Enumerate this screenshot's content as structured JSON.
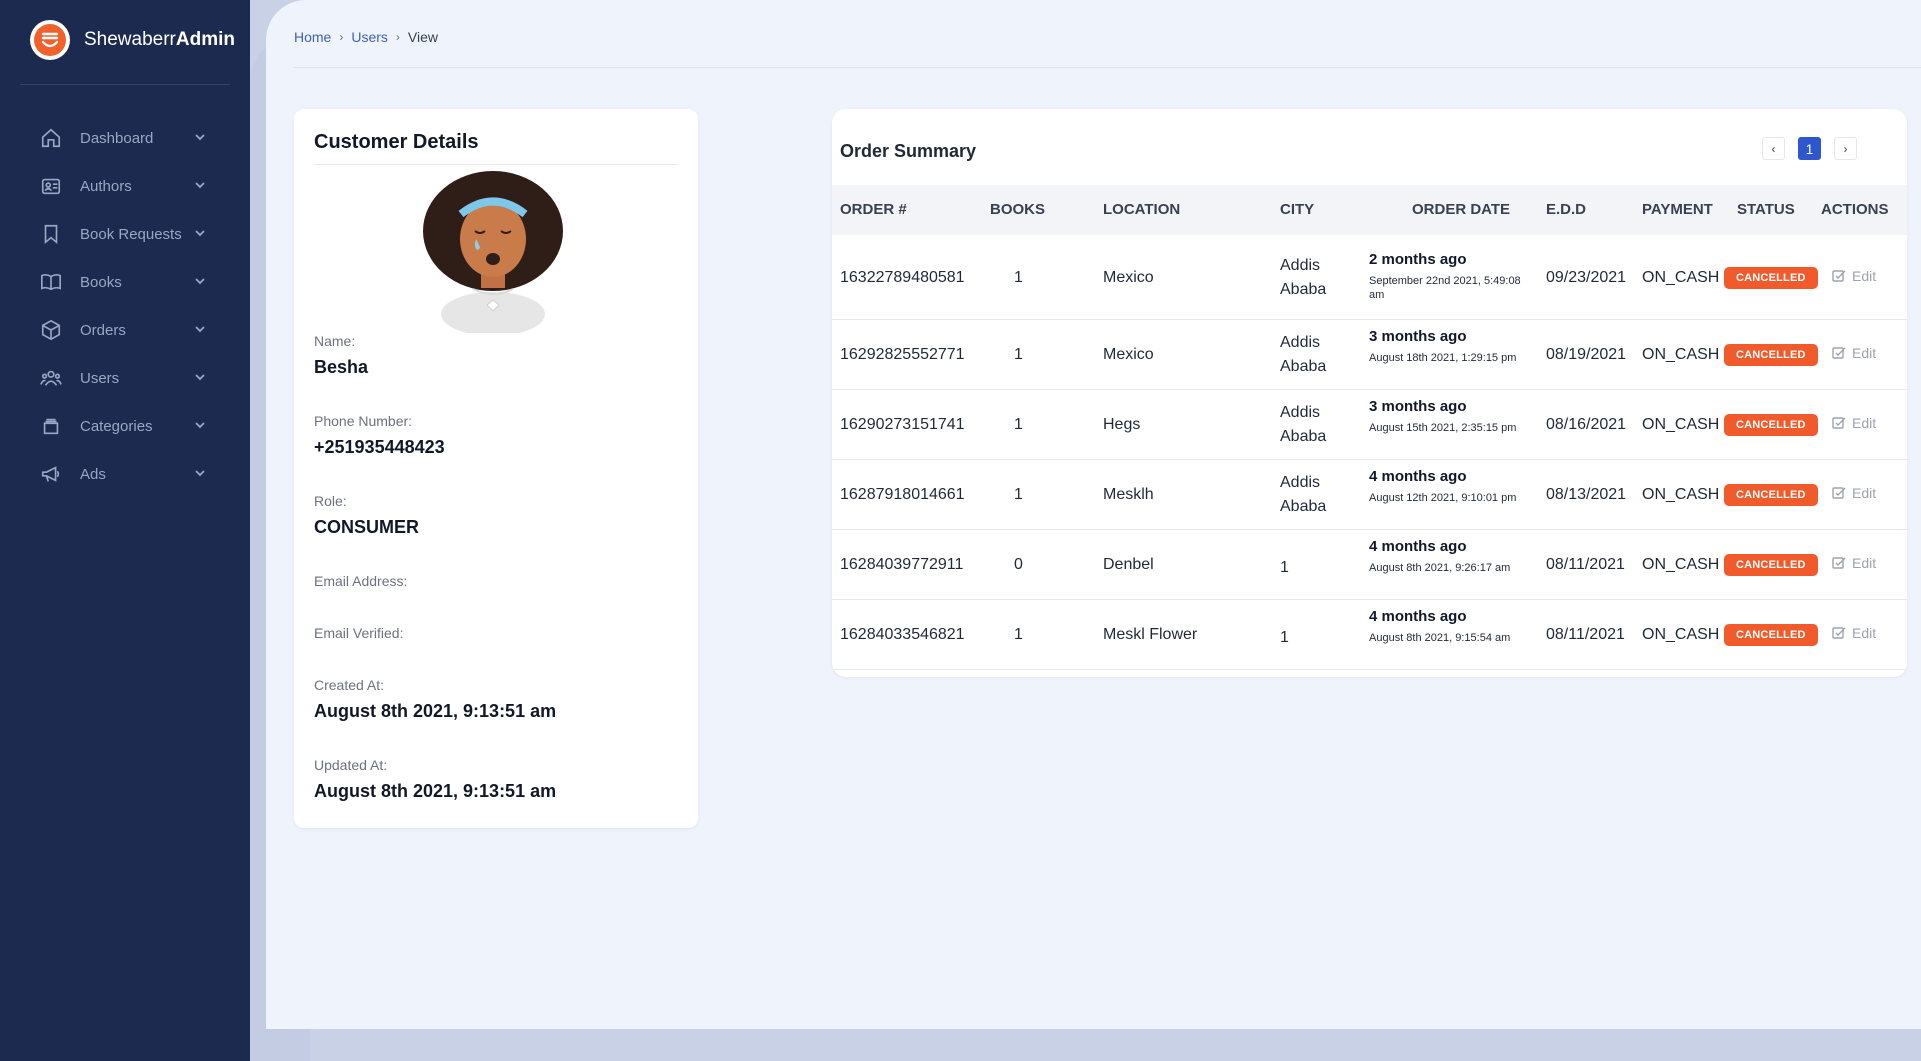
{
  "app": {
    "brand_prefix": "Shewaberr",
    "brand_suffix": "Admin"
  },
  "sidebar": {
    "items": [
      {
        "label": "Dashboard",
        "icon": "home-icon"
      },
      {
        "label": "Authors",
        "icon": "id-card-icon"
      },
      {
        "label": "Book Requests",
        "icon": "bookmark-icon"
      },
      {
        "label": "Books",
        "icon": "book-open-icon"
      },
      {
        "label": "Orders",
        "icon": "cube-icon"
      },
      {
        "label": "Users",
        "icon": "users-icon"
      },
      {
        "label": "Categories",
        "icon": "archive-icon"
      },
      {
        "label": "Ads",
        "icon": "megaphone-icon"
      }
    ]
  },
  "breadcrumb": {
    "home": "Home",
    "users": "Users",
    "current": "View"
  },
  "customer": {
    "title": "Customer Details",
    "name_label": "Name:",
    "name": "Besha",
    "phone_label": "Phone Number:",
    "phone": "+251935448423",
    "role_label": "Role:",
    "role": "CONSUMER",
    "email_label": "Email Address:",
    "email_verified_label": "Email Verified:",
    "created_label": "Created At:",
    "created": "August 8th 2021, 9:13:51 am",
    "updated_label": "Updated At:",
    "updated": "August 8th 2021, 9:13:51 am"
  },
  "orders": {
    "title": "Order Summary",
    "pager": {
      "prev": "‹",
      "page": "1",
      "next": "›"
    },
    "columns": [
      "ORDER #",
      "BOOKS",
      "LOCATION",
      "CITY",
      "ORDER DATE",
      "E.D.D",
      "PAYMENT",
      "STATUS",
      "ACTIONS"
    ],
    "edit_label": "Edit",
    "rows": [
      {
        "order": "16322789480581",
        "books": "1",
        "location": "Mexico",
        "city": [
          "Addis",
          "Ababa"
        ],
        "date_rel": "2 months ago",
        "date_abs": "September 22nd 2021, 5:49:08 am",
        "edd": "09/23/2021",
        "payment": "ON_CASH",
        "status": "CANCELLED"
      },
      {
        "order": "16292825552771",
        "books": "1",
        "location": "Mexico",
        "city": [
          "Addis",
          "Ababa"
        ],
        "date_rel": "3 months ago",
        "date_abs": "August 18th 2021, 1:29:15 pm",
        "edd": "08/19/2021",
        "payment": "ON_CASH",
        "status": "CANCELLED"
      },
      {
        "order": "16290273151741",
        "books": "1",
        "location": "Hegs",
        "city": [
          "Addis",
          "Ababa"
        ],
        "date_rel": "3 months ago",
        "date_abs": "August 15th 2021, 2:35:15 pm",
        "edd": "08/16/2021",
        "payment": "ON_CASH",
        "status": "CANCELLED"
      },
      {
        "order": "16287918014661",
        "books": "1",
        "location": "Mesklh",
        "city": [
          "Addis",
          "Ababa"
        ],
        "date_rel": "4 months ago",
        "date_abs": "August 12th 2021, 9:10:01 pm",
        "edd": "08/13/2021",
        "payment": "ON_CASH",
        "status": "CANCELLED"
      },
      {
        "order": "16284039772911",
        "books": "0",
        "location": "Denbel",
        "city": [
          "1"
        ],
        "date_rel": "4 months ago",
        "date_abs": "August 8th 2021, 9:26:17 am",
        "edd": "08/11/2021",
        "payment": "ON_CASH",
        "status": "CANCELLED"
      },
      {
        "order": "16284033546821",
        "books": "1",
        "location": "Meskl Flower",
        "city": [
          "1"
        ],
        "date_rel": "4 months ago",
        "date_abs": "August 8th 2021, 9:15:54 am",
        "edd": "08/11/2021",
        "payment": "ON_CASH",
        "status": "CANCELLED"
      }
    ]
  },
  "colors": {
    "sidebar": "#1b2a4e",
    "accent": "#2d56cf",
    "cancelled": "#f15a2b",
    "brand_logo": "#f0612b"
  }
}
